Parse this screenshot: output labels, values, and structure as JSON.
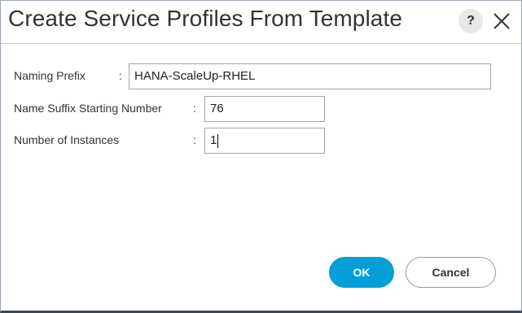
{
  "dialog": {
    "title": "Create Service Profiles From Template",
    "help_label": "?"
  },
  "form": {
    "naming_prefix": {
      "label": "Naming Prefix",
      "colon": ":",
      "value": "HANA-ScaleUp-RHEL"
    },
    "name_suffix": {
      "label": "Name Suffix Starting Number",
      "colon": ":",
      "value": "76"
    },
    "instances": {
      "label": "Number of Instances",
      "colon": ":",
      "value": "1"
    }
  },
  "buttons": {
    "ok_label": "OK",
    "cancel_label": "Cancel"
  },
  "colors": {
    "accent": "#049fd9",
    "text": "#333333"
  },
  "icons": {
    "help": "help-icon",
    "close": "close-icon"
  }
}
